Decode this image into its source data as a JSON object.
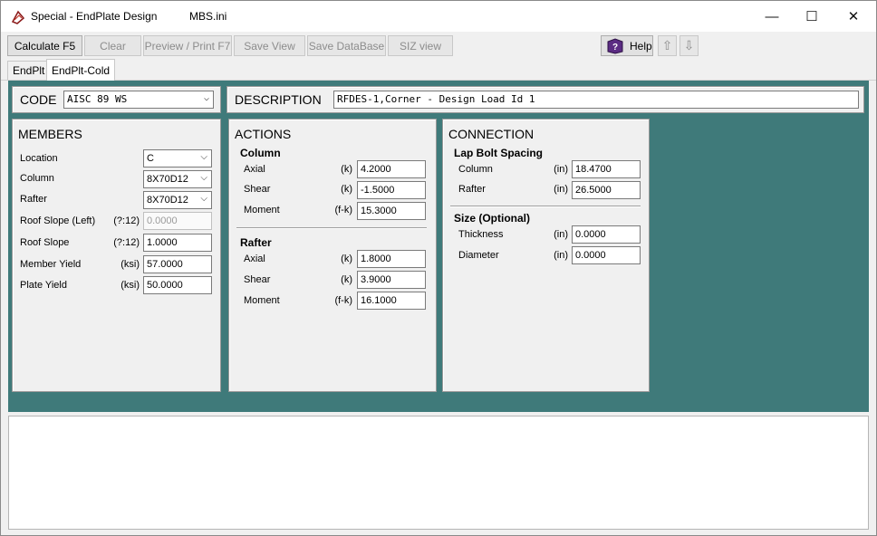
{
  "window": {
    "title": "Special - EndPlate Design",
    "file": "MBS.ini",
    "minimize": "—",
    "maximize": "☐",
    "close": "✕"
  },
  "toolbar": {
    "calculate": "Calculate  F5",
    "clear": "Clear",
    "preview": "Preview / Print F7",
    "save_view": "Save View",
    "save_database": "Save DataBase",
    "siz_view": "SIZ view",
    "help": "Help",
    "up_icon": "⇧",
    "down_icon": "⇩"
  },
  "tabs": [
    "EndPlt",
    "EndPlt-Cold"
  ],
  "code": {
    "label": "CODE",
    "value": "AISC 89 WS"
  },
  "description": {
    "label": "DESCRIPTION",
    "value": "RFDES-1,Corner - Design Load Id 1"
  },
  "members": {
    "title": "MEMBERS",
    "location": {
      "label": "Location",
      "value": "C"
    },
    "column": {
      "label": "Column",
      "value": "8X70D12"
    },
    "rafter": {
      "label": "Rafter",
      "value": "8X70D12"
    },
    "roof_slope_left": {
      "label": "Roof Slope (Left)",
      "unit": "(?:12)",
      "value": "0.0000"
    },
    "roof_slope": {
      "label": "Roof Slope",
      "unit": "(?:12)",
      "value": "1.0000"
    },
    "member_yield": {
      "label": "Member Yield",
      "unit": "(ksi)",
      "value": "57.0000"
    },
    "plate_yield": {
      "label": "Plate Yield",
      "unit": "(ksi)",
      "value": "50.0000"
    }
  },
  "actions": {
    "title": "ACTIONS",
    "column_header": "Column",
    "column": {
      "axial": {
        "label": "Axial",
        "unit": "(k)",
        "value": "4.2000"
      },
      "shear": {
        "label": "Shear",
        "unit": "(k)",
        "value": "-1.5000"
      },
      "moment": {
        "label": "Moment",
        "unit": "(f-k)",
        "value": "15.3000"
      }
    },
    "rafter_header": "Rafter",
    "rafter": {
      "axial": {
        "label": "Axial",
        "unit": "(k)",
        "value": "1.8000"
      },
      "shear": {
        "label": "Shear",
        "unit": "(k)",
        "value": "3.9000"
      },
      "moment": {
        "label": "Moment",
        "unit": "(f-k)",
        "value": "16.1000"
      }
    }
  },
  "connection": {
    "title": "CONNECTION",
    "lap_header": "Lap Bolt Spacing",
    "column": {
      "label": "Column",
      "unit": "(in)",
      "value": "18.4700"
    },
    "rafter": {
      "label": "Rafter",
      "unit": "(in)",
      "value": "26.5000"
    },
    "size_header": "Size (Optional)",
    "thickness": {
      "label": "Thickness",
      "unit": "(in)",
      "value": "0.0000"
    },
    "diameter": {
      "label": "Diameter",
      "unit": "(in)",
      "value": "0.0000"
    }
  }
}
